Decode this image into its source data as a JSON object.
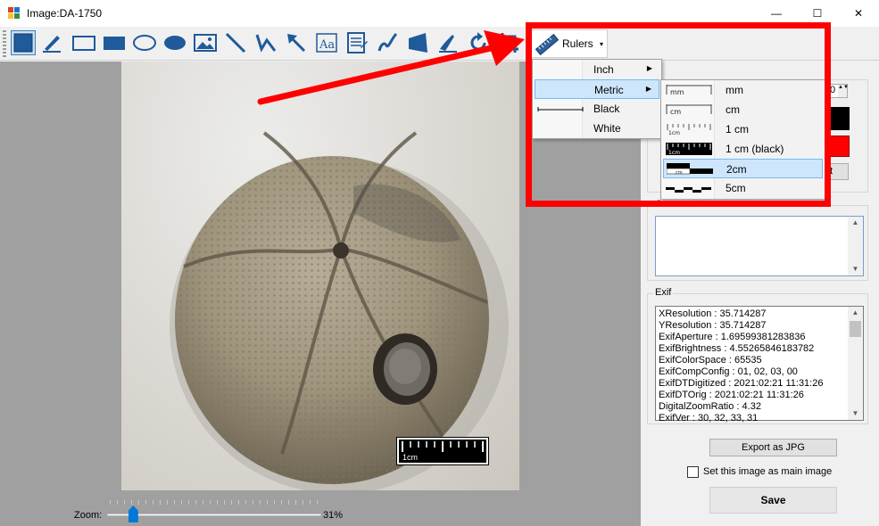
{
  "window": {
    "title": "Image:DA-1750",
    "minimize": "—",
    "maximize": "☐",
    "close": "✕"
  },
  "toolbar": {
    "rulers_label": "Rulers",
    "rulers_arrow": "▾"
  },
  "rulers_menu": {
    "items": [
      {
        "label": "Inch",
        "has_submenu": true
      },
      {
        "label": "Metric",
        "has_submenu": true,
        "highlighted": true
      },
      {
        "label": "Black",
        "has_submenu": false
      },
      {
        "label": "White",
        "has_submenu": false
      }
    ],
    "arrow": "▶"
  },
  "metric_submenu": {
    "items": [
      {
        "label": "mm",
        "icon_text": "mm"
      },
      {
        "label": "cm",
        "icon_text": "cm"
      },
      {
        "label": "1 cm",
        "icon_text": "1cm"
      },
      {
        "label": "1 cm (black)",
        "icon_text": "1cm"
      },
      {
        "label": "2cm",
        "icon_text": "cm",
        "highlighted": true
      },
      {
        "label": "5cm",
        "icon_text": ""
      }
    ]
  },
  "image": {
    "scalebar_label": "1cm"
  },
  "zoom": {
    "label": "Zoom:",
    "value_text": "31%",
    "fraction": 0.12
  },
  "properties": {
    "spin_value": "0",
    "small_button_label": "t",
    "spin_arrows": "▲▼"
  },
  "comment": {
    "legend": "Comment",
    "value": "",
    "scroll_up": "▲",
    "scroll_down": "▼"
  },
  "exif": {
    "legend": "Exif",
    "lines": [
      "XResolution :  35.714287",
      "YResolution :  35.714287",
      "ExifAperture :  1.69599381283836",
      "ExifBrightness :  4.55265846183782",
      "ExifColorSpace :  65535",
      "ExifCompConfig : 01, 02, 03, 00",
      "ExifDTDigitized :  2021:02:21 11:31:26",
      "ExifDTOrig : 2021:02:21 11:31:26",
      "DigitalZoomRatio :  4.32",
      "ExifVer : 30, 32, 33, 31"
    ],
    "scroll_up": "▲",
    "scroll_down": "▼"
  },
  "actions": {
    "export_label": "Export as JPG",
    "main_image_label": "Set this image as main image",
    "main_image_checked": false,
    "save_label": "Save"
  },
  "colors": {
    "accent": "#0078d7",
    "tool_blue": "#1f5a9a",
    "highlight": "#ff0000"
  }
}
